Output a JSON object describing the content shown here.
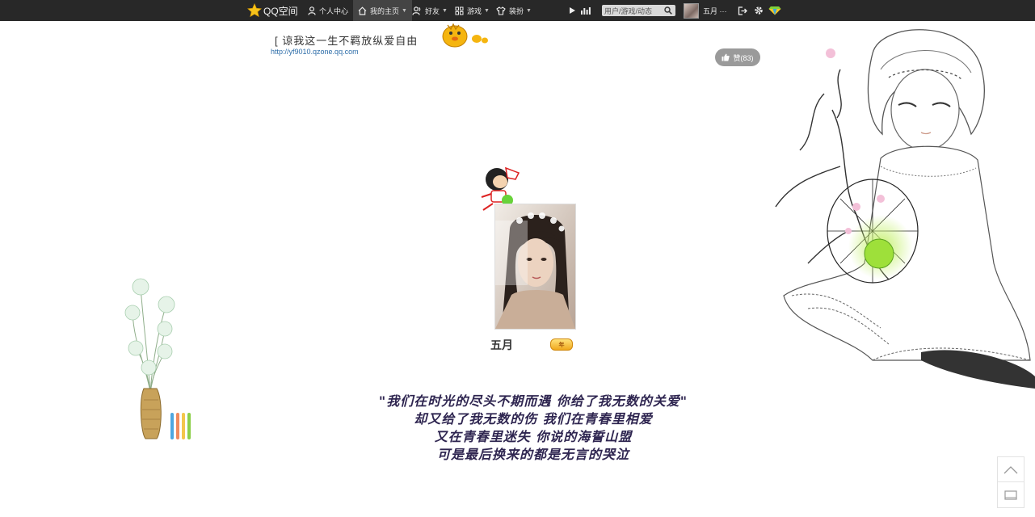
{
  "topbar": {
    "logo_text": "QQ空间",
    "nav": {
      "personal_center": "个人中心",
      "my_home": "我的主页",
      "friends": "好友",
      "games": "游戏",
      "decorate": "装扮"
    },
    "search_placeholder": "用户/游戏/动态",
    "user_name": "五月 ···"
  },
  "header": {
    "marquee_text": "[ 谅我这一生不羁放纵爱自由",
    "space_url": "http://yf9010.qzone.qq.com",
    "like_label": "赞(83)"
  },
  "profile": {
    "nickname": "五月",
    "vip_badge": "年"
  },
  "poem": {
    "lines": [
      "\"我们在时光的尽头不期而遇 你给了我无数的关爱\"",
      "却又给了我无数的伤 我们在青春里相爱",
      "又在青春里迷失 你说的海誓山盟",
      "可是最后换来的都是无言的哭泣"
    ]
  },
  "colors": {
    "topbar_bg": "#282828",
    "link": "#2b6ca8",
    "poem": "#2e2550",
    "like_bg": "#9a9a9a"
  },
  "icons": [
    "qq-star-icon",
    "user-icon",
    "home-icon",
    "friends-icon",
    "grid-icon",
    "shirt-icon",
    "play-icon",
    "bars-icon",
    "search-icon",
    "logout-icon",
    "gear-icon",
    "diamond-icon",
    "thumbs-up-icon",
    "arrow-up-icon",
    "window-icon"
  ]
}
